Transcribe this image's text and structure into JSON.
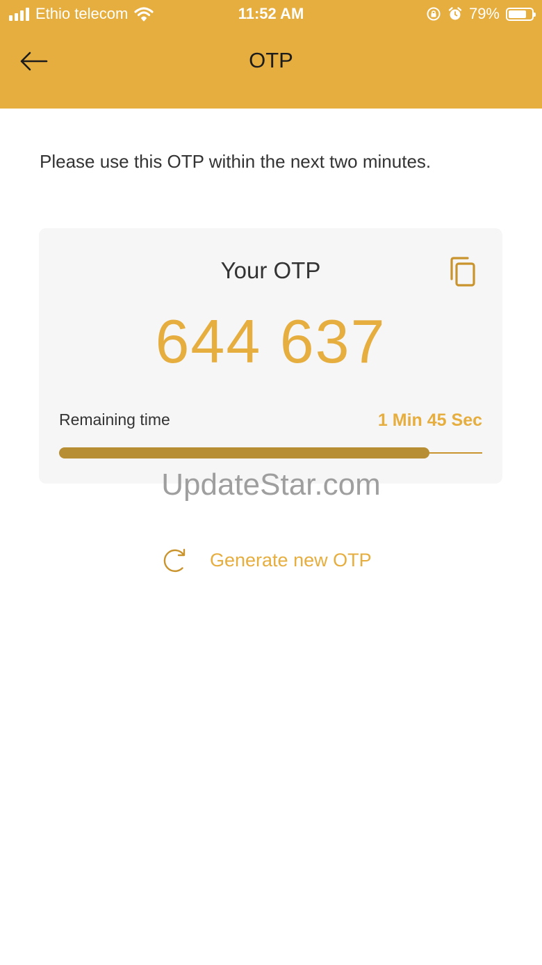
{
  "status_bar": {
    "carrier": "Ethio telecom",
    "time": "11:52 AM",
    "battery_percent": "79%",
    "battery_level": 0.79
  },
  "header": {
    "title": "OTP",
    "back_icon": "arrow-left-icon"
  },
  "instruction": "Please use this OTP within the next two minutes.",
  "otp_card": {
    "title": "Your OTP",
    "code": "644 637",
    "copy_icon": "copy-icon",
    "remaining_label": "Remaining time",
    "remaining_value": "1 Min 45 Sec",
    "remaining_fraction": 0.875
  },
  "watermark": "UpdateStar.com",
  "actions": {
    "generate_label": "Generate new OTP",
    "generate_icon": "refresh-icon"
  },
  "colors": {
    "accent": "#e6ad3f",
    "progress": "#b88e35",
    "card_background": "#f6f6f6"
  }
}
